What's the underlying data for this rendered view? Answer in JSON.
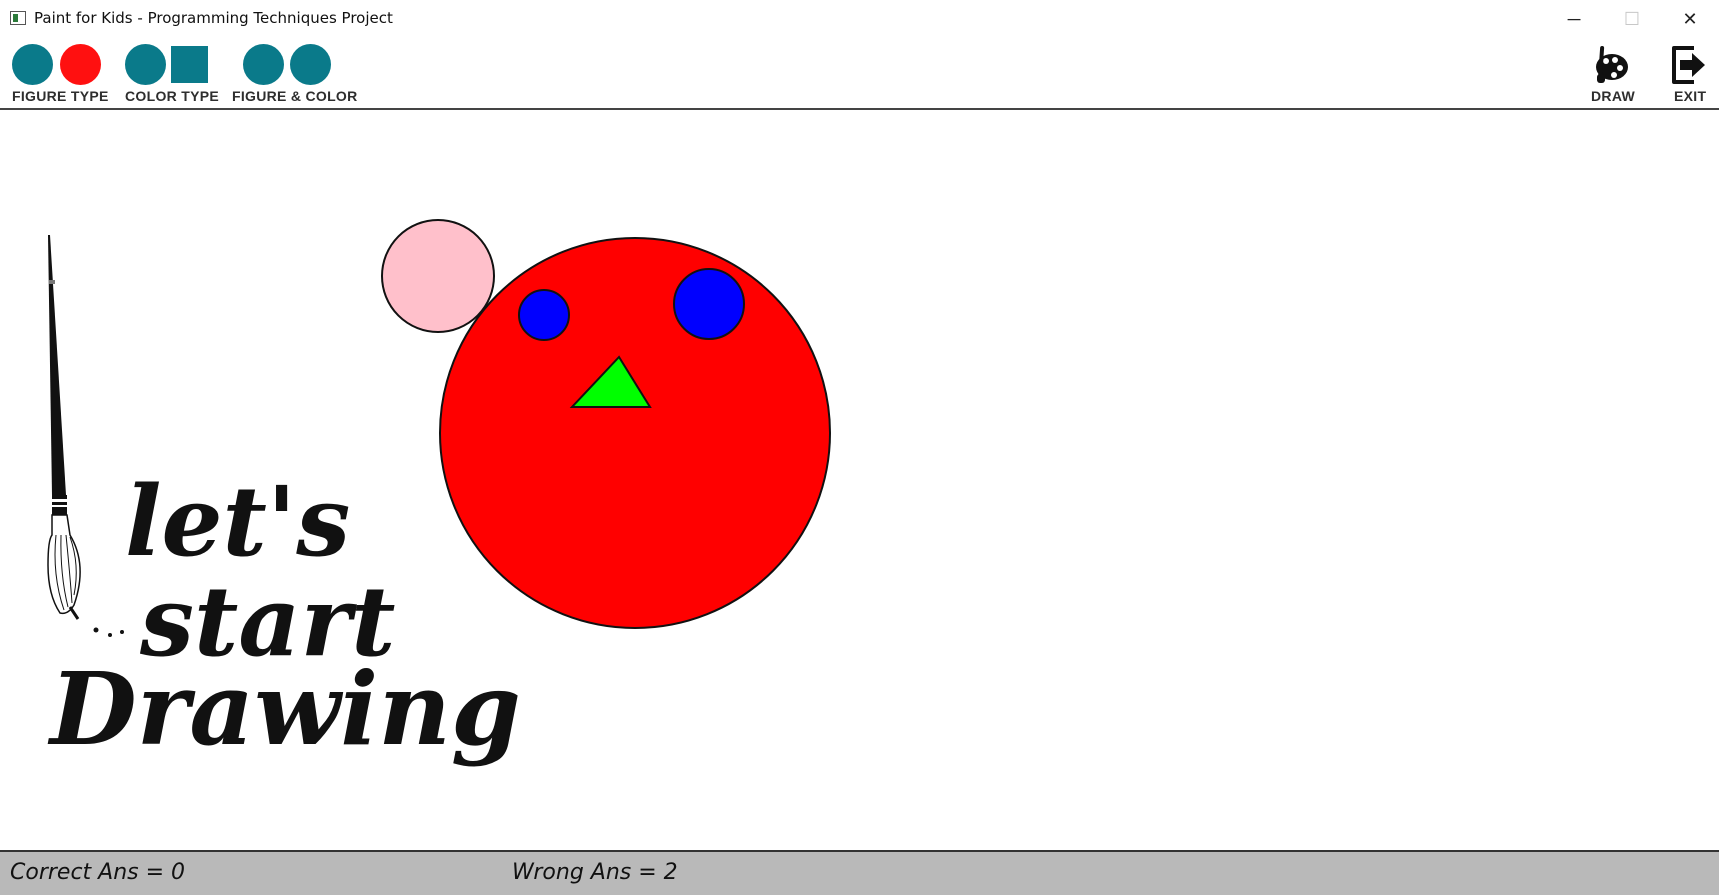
{
  "window": {
    "title": "Paint for Kids - Programming Techniques Project",
    "minimize_glyph": "─",
    "maximize_glyph": "☐",
    "close_glyph": "✕"
  },
  "toolbar": {
    "left_tools": [
      {
        "label": "FIGURE TYPE",
        "icon": "teal-red-circles-icon"
      },
      {
        "label": "COLOR TYPE",
        "icon": "circle-square-icon"
      },
      {
        "label": "FIGURE & COLOR",
        "icon": "two-circles-icon"
      }
    ],
    "draw_label": "DRAW",
    "exit_label": "EXIT"
  },
  "canvas": {
    "branding": {
      "line1": "let's",
      "line2": "start",
      "line3": "Drawing"
    },
    "shapes": [
      {
        "type": "circle",
        "fill": "#ffc0cb",
        "role": "small pink circle"
      },
      {
        "type": "circle",
        "fill": "#ff0000",
        "role": "large red circle"
      },
      {
        "type": "circle",
        "fill": "#0000ff",
        "role": "left blue eye"
      },
      {
        "type": "circle",
        "fill": "#0000ff",
        "role": "right blue eye"
      },
      {
        "type": "triangle",
        "fill": "#00ff00",
        "role": "green nose"
      }
    ]
  },
  "status": {
    "correct": "Correct Ans = 0",
    "wrong": "Wrong Ans = 2"
  },
  "colors": {
    "teal": "#0a7a8a",
    "red": "#ff1010",
    "status_bg": "#b9b9b9"
  }
}
